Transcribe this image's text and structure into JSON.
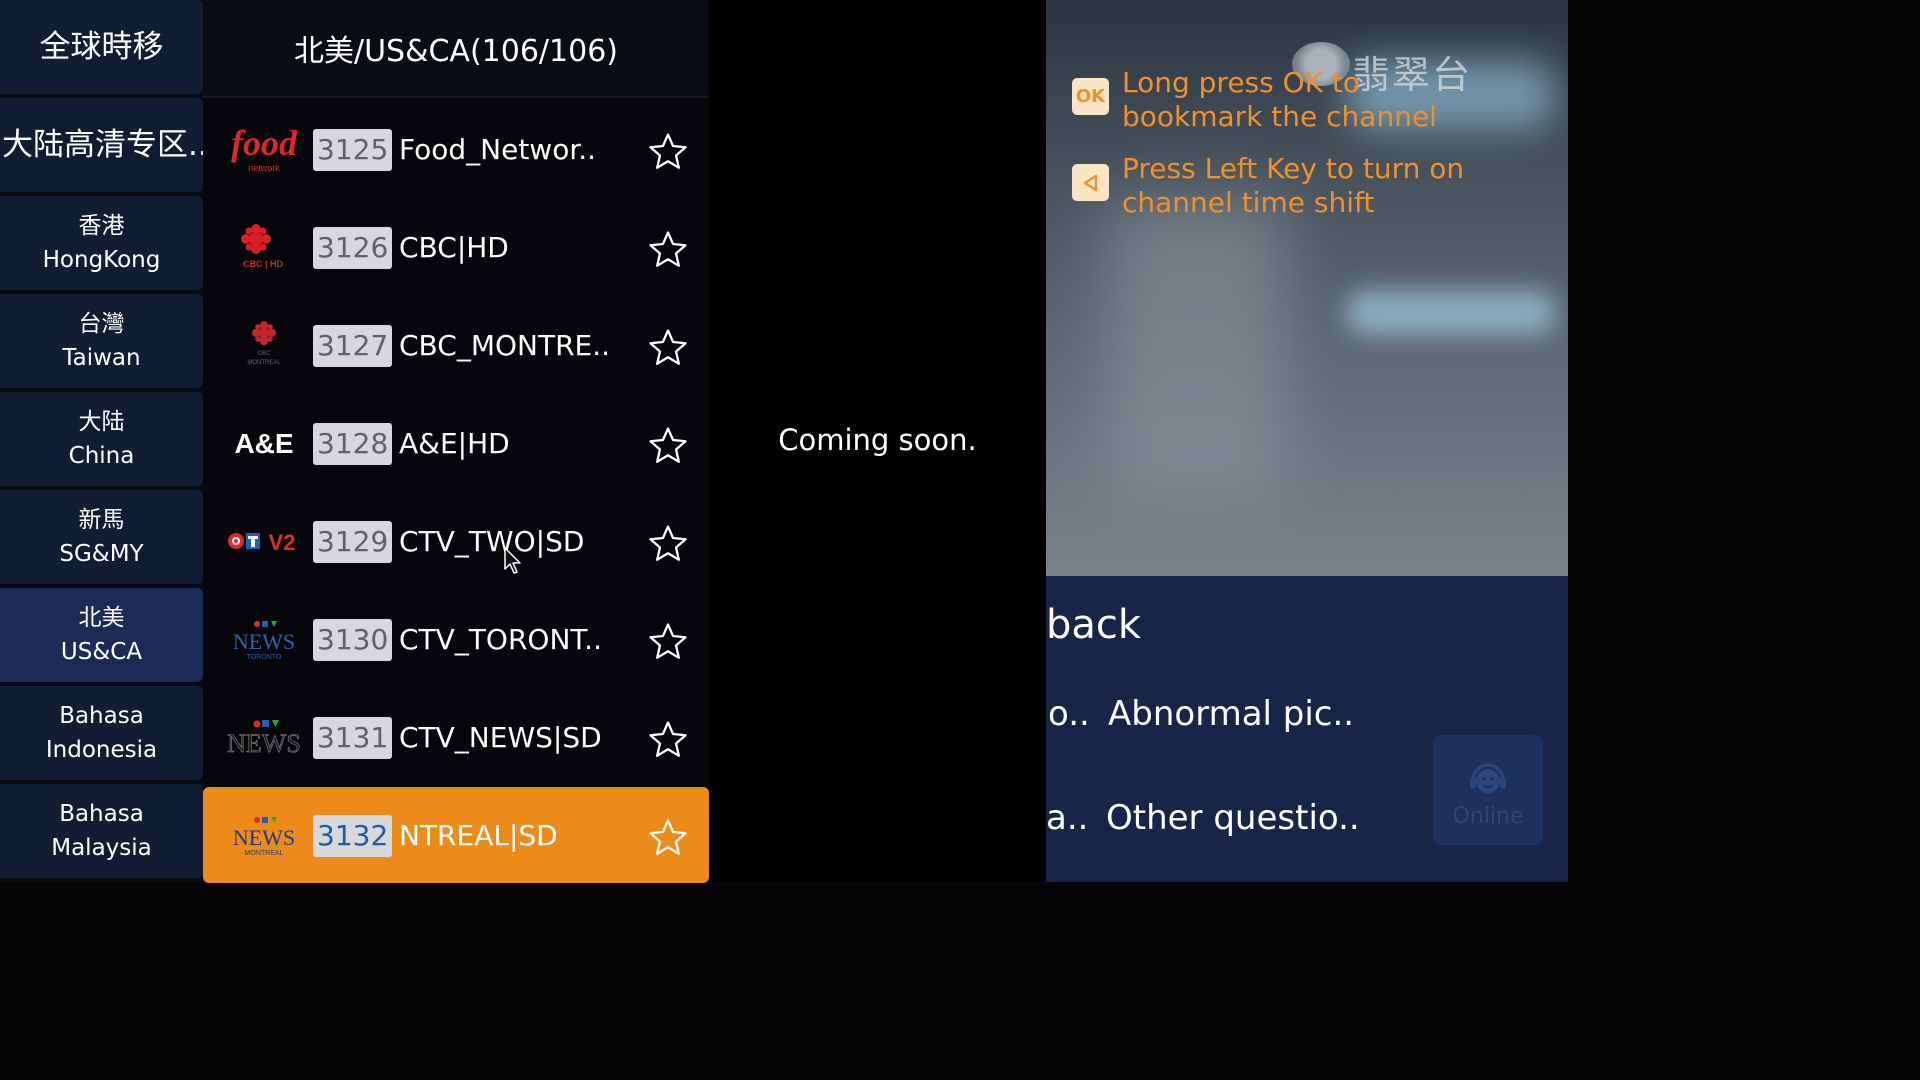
{
  "regions": {
    "header": "全球時移",
    "items": [
      {
        "label": "大陆高清专区.."
      },
      {
        "line1": "香港",
        "line2": "HongKong"
      },
      {
        "line1": "台灣",
        "line2": "Taiwan"
      },
      {
        "line1": "大陆",
        "line2": "China"
      },
      {
        "line1": "新馬",
        "line2": "SG&MY"
      },
      {
        "line1": "北美",
        "line2": "US&CA",
        "active": true
      },
      {
        "line1": "Bahasa",
        "line2": "Indonesia"
      },
      {
        "line1": "Bahasa",
        "line2": "Malaysia"
      }
    ]
  },
  "channel_list": {
    "title": "北美/US&CA(106/106)",
    "channels": [
      {
        "number": "3125",
        "name": "Food_Networ..",
        "logo": "food-network-logo",
        "favorite": false
      },
      {
        "number": "3126",
        "name": "CBC|HD",
        "logo": "cbc-hd-logo",
        "favorite": false
      },
      {
        "number": "3127",
        "name": "CBC_MONTRE..",
        "logo": "cbc-montreal-logo",
        "favorite": false
      },
      {
        "number": "3128",
        "name": "A&E|HD",
        "logo": "ae-logo",
        "favorite": false
      },
      {
        "number": "3129",
        "name": "CTV_TWO|SD",
        "logo": "ctv2-logo",
        "favorite": false
      },
      {
        "number": "3130",
        "name": "CTV_TORONT..",
        "logo": "ctv-news-toronto-logo",
        "favorite": false
      },
      {
        "number": "3131",
        "name": "CTV_NEWS|SD",
        "logo": "ctv-news-logo",
        "favorite": false
      },
      {
        "number": "3132",
        "name": "NTREAL|SD",
        "logo": "ctv-news-montreal-logo",
        "favorite": false,
        "selected": true
      }
    ],
    "logo_text": {
      "food": "food",
      "food_sub": "network",
      "cbc_sub": "CBC | HD",
      "cbc_montreal_sub1": "CBC",
      "cbc_montreal_sub2": "MONTREAL",
      "ae": "A&E",
      "ctv2_v": "V2",
      "news": "NEWS",
      "toronto": "TORONTO",
      "montreal": "MONTREAL"
    }
  },
  "preview": {
    "status_text": "Coming soon."
  },
  "video": {
    "watermark_text": "翡翠台",
    "tips": [
      {
        "icon": "ok-icon",
        "icon_text": "OK",
        "text": "Long press OK to bookmark the channel"
      },
      {
        "icon": "left-arrow-icon",
        "icon_text": "",
        "text": "Press Left Key to turn on channel time shift"
      }
    ]
  },
  "feedback": {
    "title": "back",
    "items": [
      {
        "prefix": "o..",
        "label": "Abnormal pic.."
      },
      {
        "prefix": "a..",
        "label": "Other questio.."
      }
    ],
    "online_label": "Online"
  },
  "colors": {
    "accent_orange": "#ec8a1a",
    "tip_orange": "#f0902a",
    "region_bg": "#121c33",
    "region_active_bg": "#1c2a55",
    "feedback_bg": "#192548"
  }
}
